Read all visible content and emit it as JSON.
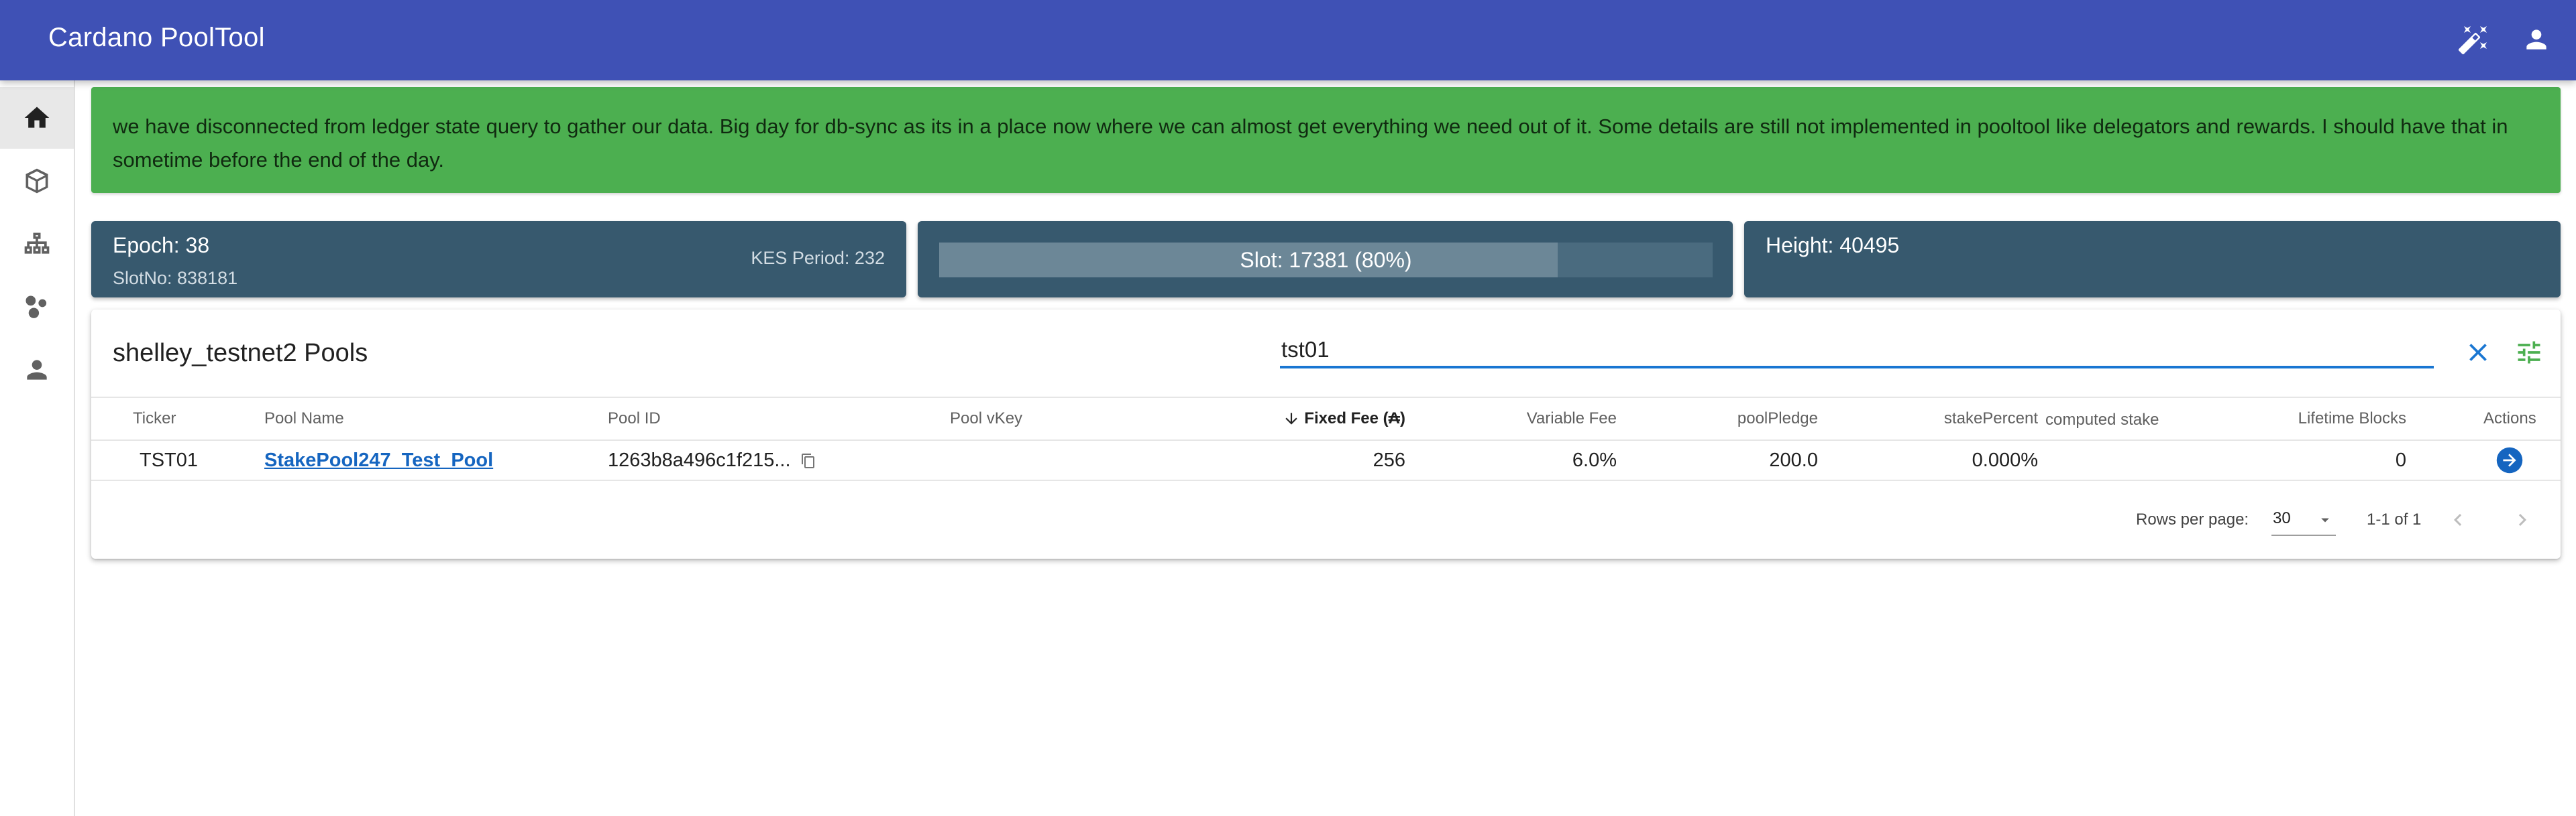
{
  "app": {
    "title": "Cardano PoolTool"
  },
  "header_icons": [
    "theme-toggle-icon",
    "account-icon"
  ],
  "nav": [
    {
      "icon": "home-icon",
      "active": true
    },
    {
      "icon": "cube-icon",
      "active": false
    },
    {
      "icon": "network-icon",
      "active": false
    },
    {
      "icon": "circles-icon",
      "active": false
    },
    {
      "icon": "person-icon",
      "active": false
    }
  ],
  "banner": {
    "text": "we have disconnected from ledger state query to gather our data. Big day for db-sync as its in a place now where we can almost get everything we need out of it. Some details are still not implemented in pooltool like delegators and rewards. I should have that in sometime before the end of the day."
  },
  "stats": {
    "epoch": "Epoch: 38",
    "slot_no": "SlotNo: 838181",
    "kes_period": "KES Period: 232",
    "slot": "Slot: 17381 (80%)",
    "slot_progress": 0.8,
    "height": "Height: 40495"
  },
  "pools": {
    "title": "shelley_testnet2 Pools",
    "search_value": "tst01",
    "columns": {
      "ticker": "Ticker",
      "pool_name": "Pool Name",
      "pool_id": "Pool ID",
      "pool_vkey": "Pool vKey",
      "fixed_fee": "Fixed Fee (₳)",
      "variable_fee": "Variable Fee",
      "pledge": "poolPledge",
      "stake_percent": "stakePercent",
      "computed_stake": "computed stake",
      "lifetime_blocks": "Lifetime Blocks",
      "actions": "Actions"
    },
    "rows": [
      {
        "ticker": "TST01",
        "pool_name": "StakePool247_Test_Pool",
        "pool_id": "1263b8a496c1f215...",
        "pool_vkey": "",
        "fixed_fee": "256",
        "variable_fee": "6.0%",
        "pledge": "200.0",
        "stake_percent": "0.000%",
        "computed_stake": "",
        "lifetime_blocks": "0"
      }
    ],
    "footer": {
      "rows_per_page_label": "Rows per page:",
      "rows_per_page_value": "30",
      "range": "1-1 of 1"
    }
  },
  "colors": {
    "appbar": "#3f51b5",
    "banner": "#4caf50",
    "stat_card": "#37596e",
    "link": "#1565c0",
    "filter_icon": "#4caf50"
  }
}
